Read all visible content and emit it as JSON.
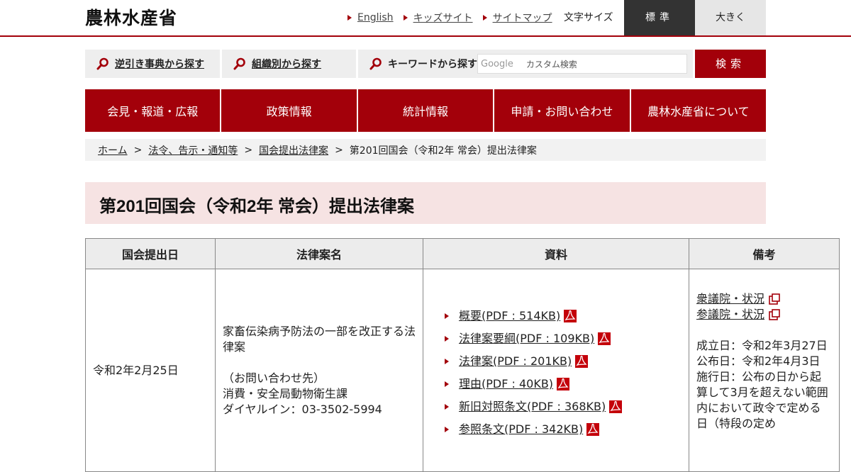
{
  "header": {
    "logo": "農林水産省",
    "links": [
      "English",
      "キッズサイト",
      "サイトマップ"
    ],
    "font_size_label": "文字サイズ",
    "font_size_standard": "標準",
    "font_size_large": "大きく"
  },
  "search": {
    "reverse_lookup": "逆引き事典から探す",
    "by_org": "組織別から探す",
    "keyword_label": "キーワードから探す",
    "google_label": "Google",
    "placeholder": "カスタム検索",
    "button": "検索"
  },
  "nav": [
    "会見・報道・広報",
    "政策情報",
    "統計情報",
    "申請・お問い合わせ",
    "農林水産省について"
  ],
  "breadcrumb": {
    "links": [
      "ホーム",
      "法令、告示・通知等",
      "国会提出法律案"
    ],
    "current": "第201回国会（令和2年 常会）提出法律案"
  },
  "page_title": "第201回国会（令和2年 常会）提出法律案",
  "table": {
    "headers": [
      "国会提出日",
      "法律案名",
      "資料",
      "備考"
    ],
    "row": {
      "date": "令和2年2月25日",
      "law_name": "家畜伝染病予防法の一部を改正する法律案",
      "contact_heading": "（お問い合わせ先）",
      "contact_dept": "消費・安全局動物衛生課",
      "contact_phone": "ダイヤルイン：03-3502-5994",
      "documents": [
        {
          "label": "概要(PDF : 514KB)"
        },
        {
          "label": "法律案要綱(PDF : 109KB)"
        },
        {
          "label": "法律案(PDF : 201KB)"
        },
        {
          "label": "理由(PDF : 40KB)"
        },
        {
          "label": "新旧対照条文(PDF : 368KB)"
        },
        {
          "label": "参照条文(PDF : 342KB)"
        }
      ],
      "notes_links": [
        "衆議院・状況",
        "参議院・状況"
      ],
      "notes_text": "成立日：令和2年3月27日 公布日：令和2年4月3日 施行日：公布の日から起算して3月を超えない範囲内において政令で定める日（特段の定め"
    }
  },
  "colors": {
    "accent": "#a3000a",
    "title_bg": "#f6e3e3",
    "header_cell_bg": "#ececec"
  }
}
